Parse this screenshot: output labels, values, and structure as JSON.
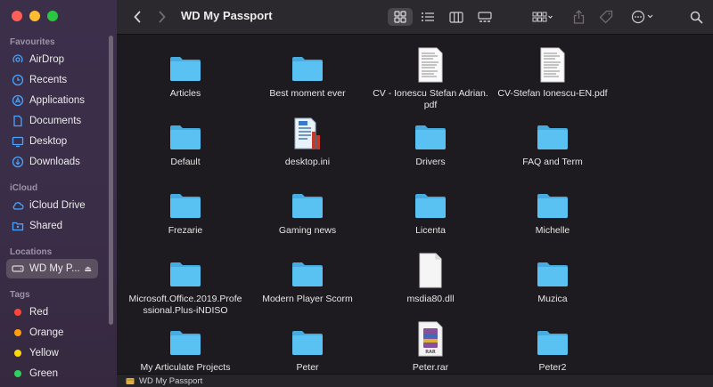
{
  "window": {
    "title": "WD My Passport"
  },
  "sidebar": {
    "favourites_header": "Favourites",
    "favourites": [
      {
        "label": "AirDrop",
        "icon": "airdrop-icon"
      },
      {
        "label": "Recents",
        "icon": "clock-icon"
      },
      {
        "label": "Applications",
        "icon": "applications-icon"
      },
      {
        "label": "Documents",
        "icon": "document-icon"
      },
      {
        "label": "Desktop",
        "icon": "desktop-icon"
      },
      {
        "label": "Downloads",
        "icon": "downloads-icon"
      }
    ],
    "icloud_header": "iCloud",
    "icloud": [
      {
        "label": "iCloud Drive",
        "icon": "cloud-icon"
      },
      {
        "label": "Shared",
        "icon": "shared-folder-icon"
      }
    ],
    "locations_header": "Locations",
    "locations": [
      {
        "label": "WD My P...",
        "icon": "drive-icon",
        "selected": true
      }
    ],
    "tags_header": "Tags",
    "tags": [
      {
        "label": "Red",
        "color": "#ff453a"
      },
      {
        "label": "Orange",
        "color": "#ff9f0a"
      },
      {
        "label": "Yellow",
        "color": "#ffd60a"
      },
      {
        "label": "Green",
        "color": "#30d158"
      }
    ]
  },
  "toolbar": {
    "back_icon": "chevron-left-icon",
    "forward_icon": "chevron-right-icon",
    "view_icons": [
      "icon-view-icon",
      "list-view-icon",
      "column-view-icon",
      "gallery-view-icon"
    ],
    "group_icon": "group-icon",
    "share_icon": "share-icon",
    "tag_icon": "tag-icon",
    "more_icon": "ellipsis-icon",
    "search_icon": "search-icon"
  },
  "files": [
    {
      "name": "Articles",
      "type": "folder"
    },
    {
      "name": "Best moment ever",
      "type": "folder"
    },
    {
      "name": "CV - Ionescu Stefan Adrian.pdf",
      "type": "pdf"
    },
    {
      "name": "CV-Stefan Ionescu-EN.pdf",
      "type": "pdf"
    },
    {
      "name": "Default",
      "type": "folder"
    },
    {
      "name": "desktop.ini",
      "type": "ini"
    },
    {
      "name": "Drivers",
      "type": "folder"
    },
    {
      "name": "FAQ and Term",
      "type": "folder"
    },
    {
      "name": "Frezarie",
      "type": "folder"
    },
    {
      "name": "Gaming news",
      "type": "folder"
    },
    {
      "name": "Licenta",
      "type": "folder"
    },
    {
      "name": "Michelle",
      "type": "folder"
    },
    {
      "name": "Microsoft.Office.2019.Professional.Plus-iNDISO",
      "type": "folder"
    },
    {
      "name": "Modern Player Scorm",
      "type": "folder"
    },
    {
      "name": "msdia80.dll",
      "type": "dll"
    },
    {
      "name": "Muzica",
      "type": "folder"
    },
    {
      "name": "My Articulate Projects",
      "type": "folder"
    },
    {
      "name": "Peter",
      "type": "folder"
    },
    {
      "name": "Peter.rar",
      "type": "rar"
    },
    {
      "name": "Peter2",
      "type": "folder"
    }
  ],
  "pathbar": {
    "label": "WD My Passport"
  },
  "colors": {
    "folder": "#5ac1f3",
    "folder_tab": "#47abe0",
    "sidebar_accent": "#4aa3ff"
  }
}
